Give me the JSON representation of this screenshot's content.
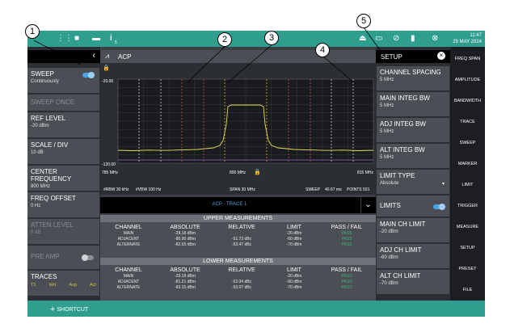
{
  "status_bar": {
    "badge_count": "5",
    "time": "11:47",
    "date": "29 MAY 2024"
  },
  "callouts": [
    "1",
    "2",
    "3",
    "4",
    "5"
  ],
  "left": {
    "sweep": {
      "label": "SWEEP",
      "value": "Continuously",
      "toggle_on": true
    },
    "sweep_once": "SWEEP ONCE",
    "ref_level": {
      "label": "REF LEVEL",
      "value": "-20 dBm"
    },
    "scale_div": {
      "label": "SCALE / DIV",
      "value": "10 dB"
    },
    "center_freq": {
      "label": "CENTER FREQUENCY",
      "value": "800 MHz"
    },
    "freq_offset": {
      "label": "FREQ OFFSET",
      "value": "0 Hz"
    },
    "atten_level": {
      "label": "ATTEN LEVEL",
      "value": "0 dB"
    },
    "pre_amp": {
      "label": "PRE AMP",
      "toggle_on": false
    },
    "traces": {
      "label": "TRACES",
      "items": [
        "T1",
        "Wrt",
        "Avg",
        "Act"
      ]
    }
  },
  "center": {
    "title": "ACP",
    "y_top": "-20.00",
    "y_bottom": "-120.00",
    "x_left": "785 MHz",
    "x_center": "800 MHz",
    "x_right": "815 MHz",
    "rbw": "#RBW 30 kHz",
    "vbw": "#VBW 100 Hz",
    "span": "SPAN 30 MHz",
    "sweep": "SWEEP",
    "sweep_time": "40.67 ms",
    "points": "POINTS 501",
    "trace_label": "ACP - TRACE 1"
  },
  "measurements": {
    "upper_title": "UPPER MEASUREMENTS",
    "lower_title": "LOWER MEASUREMENTS",
    "columns": [
      "CHANNEL",
      "ABSOLUTE",
      "RELATIVE",
      "LIMIT",
      "PASS / FAIL"
    ],
    "upper_rows": [
      [
        "MAIN",
        "-29.18 dBm",
        "",
        "-20 dBm",
        "PASS"
      ],
      [
        "ADJACENT",
        "-80.90 dBm",
        "-51.73 dBc",
        "-60 dBm",
        "PASS"
      ],
      [
        "ALTERNATE",
        "-82.65 dBm",
        "-53.47 dBc",
        "-70 dBm",
        "PASS"
      ]
    ],
    "lower_rows": [
      [
        "MAIN",
        "-29.18 dBm",
        "",
        "-20 dBm",
        "PASS"
      ],
      [
        "ADJACENT",
        "-81.21 dBm",
        "-52.04 dBc",
        "-60 dBm",
        "PASS"
      ],
      [
        "ALTERNATE",
        "-83.15 dBm",
        "-53.97 dBc",
        "-70 dBm",
        "PASS"
      ]
    ]
  },
  "setup": {
    "title": "SETUP",
    "channel_spacing": {
      "label": "CHANNEL SPACING",
      "value": "5 MHz"
    },
    "main_integ_bw": {
      "label": "MAIN INTEG BW",
      "value": "5 MHz"
    },
    "adj_integ_bw": {
      "label": "ADJ INTEG BW",
      "value": "5 MHz"
    },
    "alt_integ_bw": {
      "label": "ALT INTEG BW",
      "value": "5 MHz"
    },
    "limit_type": {
      "label": "LIMIT TYPE",
      "value": "Absolute"
    },
    "limits": {
      "label": "LIMITS",
      "toggle_on": true
    },
    "main_ch_limit": {
      "label": "MAIN CH LIMIT",
      "value": "-20 dBm"
    },
    "adj_ch_limit": {
      "label": "ADJ CH LIMIT",
      "value": "-60 dBm"
    },
    "alt_ch_limit": {
      "label": "ALT CH LIMIT",
      "value": "-70 dBm"
    }
  },
  "right_menu": [
    "FREQ SPAN",
    "AMPLITUDE",
    "BANDWIDTH",
    "TRACE",
    "SWEEP",
    "MARKER",
    "LIMIT",
    "TRIGGER",
    "MEASURE",
    "SETUP",
    "PRESET",
    "FILE"
  ],
  "bottom": {
    "shortcut": "SHORTCUT"
  },
  "colors": {
    "accent": "#2f9e8f",
    "trace": "#e8e25a",
    "main_line": "#d9a63a",
    "adj_line": "#c0504d",
    "alt_line": "#d0d0d0",
    "pass": "#3cb371"
  }
}
